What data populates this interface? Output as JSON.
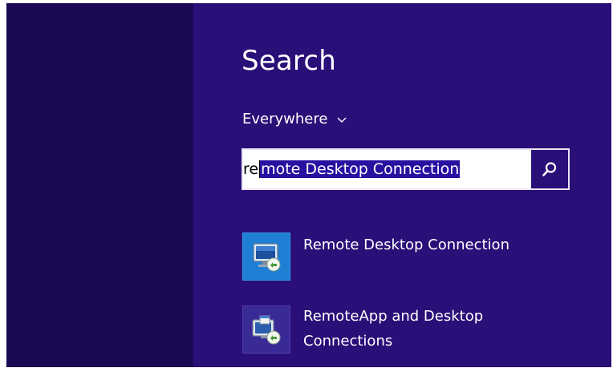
{
  "search_panel": {
    "title": "Search",
    "scope": {
      "label": "Everywhere",
      "icon": "chevron-down-icon"
    },
    "search_box": {
      "typed_text": "re",
      "autocomplete_text": "mote Desktop Connection",
      "button_icon": "search-icon"
    },
    "results": [
      {
        "label_line1": "Remote Desktop Connection",
        "label_line2": "",
        "icon": "remote-desktop-icon"
      },
      {
        "label_line1": "RemoteApp and Desktop",
        "label_line2": "Connections",
        "icon": "remoteapp-icon"
      }
    ]
  },
  "colors": {
    "backdrop": "#1c0955",
    "panel": "#2a0f78",
    "selection": "#2a10a0",
    "text": "#ffffff"
  }
}
